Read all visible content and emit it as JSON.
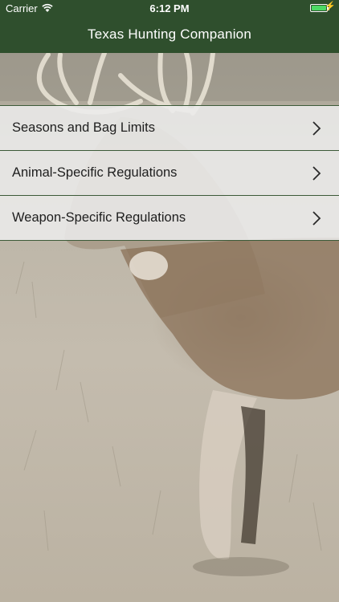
{
  "status_bar": {
    "carrier": "Carrier",
    "time": "6:12 PM",
    "battery_level": 1.0,
    "battery_color": "#4cd964"
  },
  "nav": {
    "title": "Texas Hunting Companion",
    "background_color": "#2f4f2d"
  },
  "menu": {
    "items": [
      {
        "label": "Seasons and Bag Limits",
        "icon": "chevron-right-icon"
      },
      {
        "label": "Animal-Specific Regulations",
        "icon": "chevron-right-icon"
      },
      {
        "label": "Weapon-Specific Regulations",
        "icon": "chevron-right-icon"
      }
    ]
  },
  "background": {
    "image": "deer-photo"
  }
}
